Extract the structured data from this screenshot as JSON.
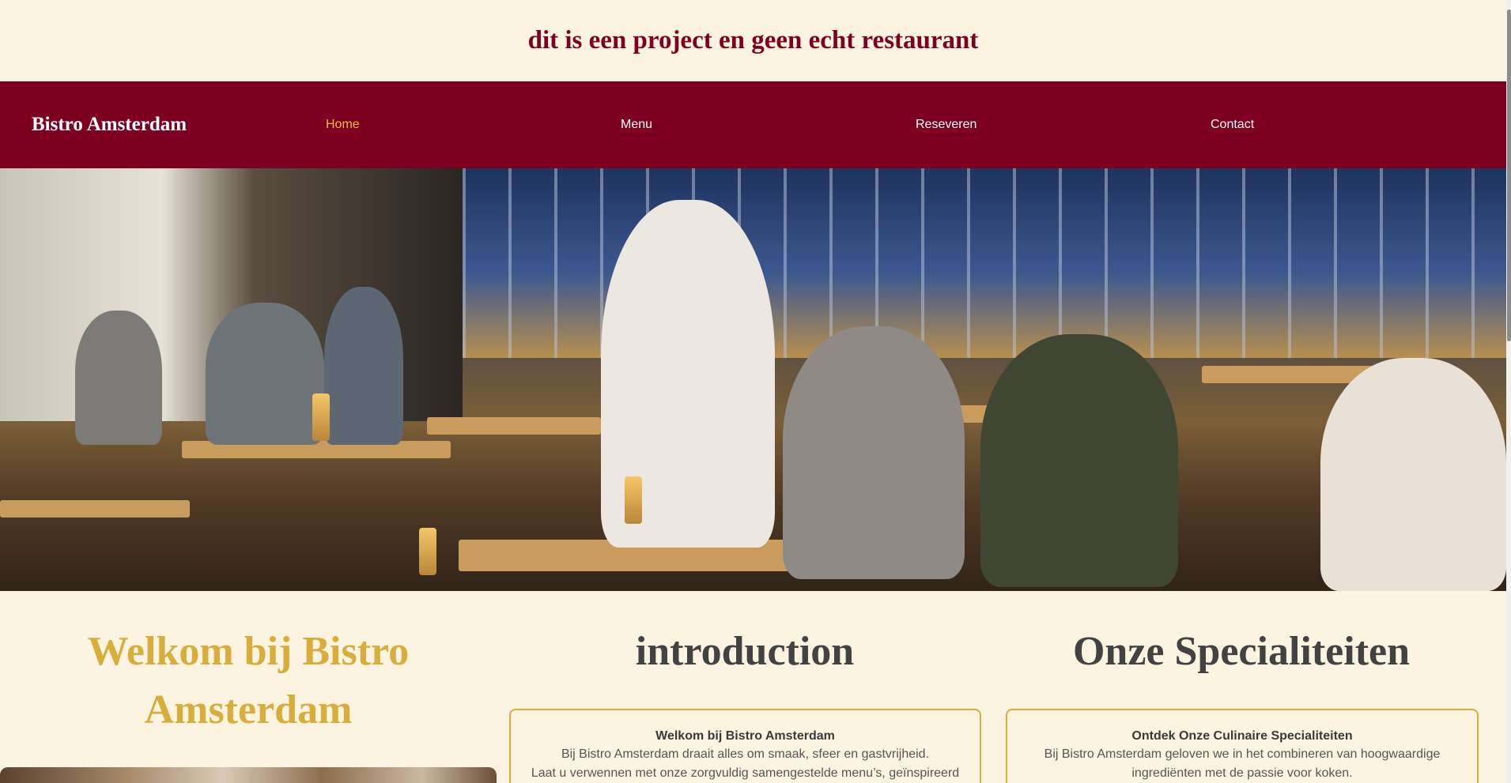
{
  "disclaimer": "dit is een project en geen echt restaurant",
  "navbar": {
    "brand": "Bistro Amsterdam",
    "links": [
      {
        "label": "Home",
        "active": true
      },
      {
        "label": "Menu",
        "active": false
      },
      {
        "label": "Reseveren",
        "active": false
      },
      {
        "label": "Contact",
        "active": false
      }
    ],
    "background": "#7d0021",
    "active_color": "#e7bf4a"
  },
  "hero": {
    "image_description_icon": "restaurant-dining-room-photo"
  },
  "sections": {
    "welcome": {
      "title_line1": "Welkom bij Bistro",
      "title_line2": "Amsterdam"
    },
    "introduction": {
      "title": "introduction",
      "card_title": "Welkom bij Bistro Amsterdam",
      "line1": "Bij Bistro Amsterdam draait alles om smaak, sfeer en gastvrijheid.",
      "line2": "Laat u verwennen met onze zorgvuldig samengestelde menu’s, geïnspireerd"
    },
    "specialties": {
      "title": "Onze Specialiteiten",
      "card_title": "Ontdek Onze Culinaire Specialiteiten",
      "line1": "Bij Bistro Amsterdam geloven we in het combineren van hoogwaardige",
      "line2": "ingrediënten met de passie voor koken."
    }
  },
  "colors": {
    "page_background": "#fdf3e1",
    "gold": "#d7ae3d",
    "burgundy": "#7d0022",
    "heading_grey": "#424242"
  }
}
